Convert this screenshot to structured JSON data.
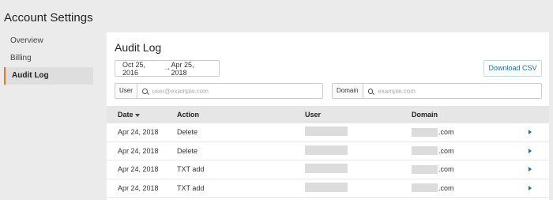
{
  "page_title": "Account Settings",
  "sidebar": {
    "items": [
      {
        "label": "Overview",
        "active": false
      },
      {
        "label": "Billing",
        "active": false
      },
      {
        "label": "Audit Log",
        "active": true
      }
    ]
  },
  "audit": {
    "title": "Audit Log",
    "date_range": {
      "start": "Oct 25, 2016",
      "arrow": "→",
      "end": "Apr 25, 2018"
    },
    "download_label": "Download CSV",
    "user_filter": {
      "label": "User",
      "placeholder": "user@example.com"
    },
    "domain_filter": {
      "label": "Domain",
      "placeholder": "example.com"
    },
    "columns": {
      "date": "Date",
      "action": "Action",
      "user": "User",
      "domain": "Domain"
    },
    "rows": [
      {
        "date": "Apr 24, 2018",
        "action": "Delete",
        "domain_suffix": ".com"
      },
      {
        "date": "Apr 24, 2018",
        "action": "Delete",
        "domain_suffix": ".com"
      },
      {
        "date": "Apr 24, 2018",
        "action": "TXT add",
        "domain_suffix": ".com"
      },
      {
        "date": "Apr 24, 2018",
        "action": "TXT add",
        "domain_suffix": ".com"
      }
    ]
  },
  "colors": {
    "accent": "#e87722",
    "link": "#1a6fa3"
  }
}
